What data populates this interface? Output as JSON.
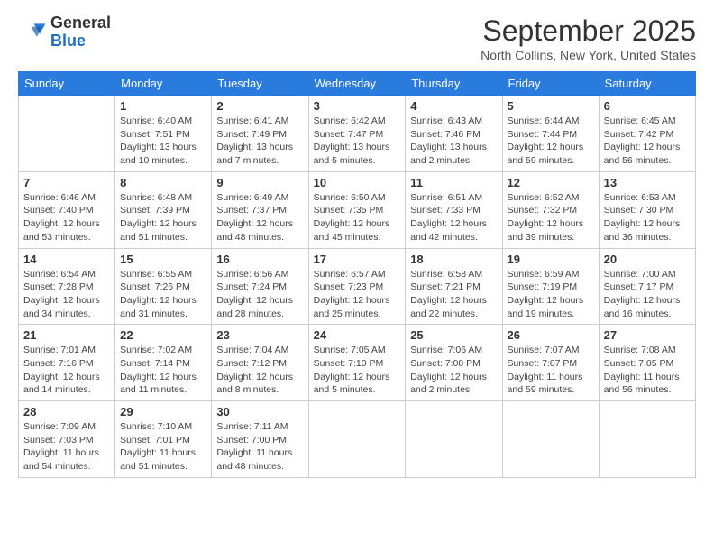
{
  "header": {
    "logo_general": "General",
    "logo_blue": "Blue",
    "month_title": "September 2025",
    "subtitle": "North Collins, New York, United States"
  },
  "days_of_week": [
    "Sunday",
    "Monday",
    "Tuesday",
    "Wednesday",
    "Thursday",
    "Friday",
    "Saturday"
  ],
  "weeks": [
    [
      {
        "day": "",
        "info": ""
      },
      {
        "day": "1",
        "info": "Sunrise: 6:40 AM\nSunset: 7:51 PM\nDaylight: 13 hours\nand 10 minutes."
      },
      {
        "day": "2",
        "info": "Sunrise: 6:41 AM\nSunset: 7:49 PM\nDaylight: 13 hours\nand 7 minutes."
      },
      {
        "day": "3",
        "info": "Sunrise: 6:42 AM\nSunset: 7:47 PM\nDaylight: 13 hours\nand 5 minutes."
      },
      {
        "day": "4",
        "info": "Sunrise: 6:43 AM\nSunset: 7:46 PM\nDaylight: 13 hours\nand 2 minutes."
      },
      {
        "day": "5",
        "info": "Sunrise: 6:44 AM\nSunset: 7:44 PM\nDaylight: 12 hours\nand 59 minutes."
      },
      {
        "day": "6",
        "info": "Sunrise: 6:45 AM\nSunset: 7:42 PM\nDaylight: 12 hours\nand 56 minutes."
      }
    ],
    [
      {
        "day": "7",
        "info": "Sunrise: 6:46 AM\nSunset: 7:40 PM\nDaylight: 12 hours\nand 53 minutes."
      },
      {
        "day": "8",
        "info": "Sunrise: 6:48 AM\nSunset: 7:39 PM\nDaylight: 12 hours\nand 51 minutes."
      },
      {
        "day": "9",
        "info": "Sunrise: 6:49 AM\nSunset: 7:37 PM\nDaylight: 12 hours\nand 48 minutes."
      },
      {
        "day": "10",
        "info": "Sunrise: 6:50 AM\nSunset: 7:35 PM\nDaylight: 12 hours\nand 45 minutes."
      },
      {
        "day": "11",
        "info": "Sunrise: 6:51 AM\nSunset: 7:33 PM\nDaylight: 12 hours\nand 42 minutes."
      },
      {
        "day": "12",
        "info": "Sunrise: 6:52 AM\nSunset: 7:32 PM\nDaylight: 12 hours\nand 39 minutes."
      },
      {
        "day": "13",
        "info": "Sunrise: 6:53 AM\nSunset: 7:30 PM\nDaylight: 12 hours\nand 36 minutes."
      }
    ],
    [
      {
        "day": "14",
        "info": "Sunrise: 6:54 AM\nSunset: 7:28 PM\nDaylight: 12 hours\nand 34 minutes."
      },
      {
        "day": "15",
        "info": "Sunrise: 6:55 AM\nSunset: 7:26 PM\nDaylight: 12 hours\nand 31 minutes."
      },
      {
        "day": "16",
        "info": "Sunrise: 6:56 AM\nSunset: 7:24 PM\nDaylight: 12 hours\nand 28 minutes."
      },
      {
        "day": "17",
        "info": "Sunrise: 6:57 AM\nSunset: 7:23 PM\nDaylight: 12 hours\nand 25 minutes."
      },
      {
        "day": "18",
        "info": "Sunrise: 6:58 AM\nSunset: 7:21 PM\nDaylight: 12 hours\nand 22 minutes."
      },
      {
        "day": "19",
        "info": "Sunrise: 6:59 AM\nSunset: 7:19 PM\nDaylight: 12 hours\nand 19 minutes."
      },
      {
        "day": "20",
        "info": "Sunrise: 7:00 AM\nSunset: 7:17 PM\nDaylight: 12 hours\nand 16 minutes."
      }
    ],
    [
      {
        "day": "21",
        "info": "Sunrise: 7:01 AM\nSunset: 7:16 PM\nDaylight: 12 hours\nand 14 minutes."
      },
      {
        "day": "22",
        "info": "Sunrise: 7:02 AM\nSunset: 7:14 PM\nDaylight: 12 hours\nand 11 minutes."
      },
      {
        "day": "23",
        "info": "Sunrise: 7:04 AM\nSunset: 7:12 PM\nDaylight: 12 hours\nand 8 minutes."
      },
      {
        "day": "24",
        "info": "Sunrise: 7:05 AM\nSunset: 7:10 PM\nDaylight: 12 hours\nand 5 minutes."
      },
      {
        "day": "25",
        "info": "Sunrise: 7:06 AM\nSunset: 7:08 PM\nDaylight: 12 hours\nand 2 minutes."
      },
      {
        "day": "26",
        "info": "Sunrise: 7:07 AM\nSunset: 7:07 PM\nDaylight: 11 hours\nand 59 minutes."
      },
      {
        "day": "27",
        "info": "Sunrise: 7:08 AM\nSunset: 7:05 PM\nDaylight: 11 hours\nand 56 minutes."
      }
    ],
    [
      {
        "day": "28",
        "info": "Sunrise: 7:09 AM\nSunset: 7:03 PM\nDaylight: 11 hours\nand 54 minutes."
      },
      {
        "day": "29",
        "info": "Sunrise: 7:10 AM\nSunset: 7:01 PM\nDaylight: 11 hours\nand 51 minutes."
      },
      {
        "day": "30",
        "info": "Sunrise: 7:11 AM\nSunset: 7:00 PM\nDaylight: 11 hours\nand 48 minutes."
      },
      {
        "day": "",
        "info": ""
      },
      {
        "day": "",
        "info": ""
      },
      {
        "day": "",
        "info": ""
      },
      {
        "day": "",
        "info": ""
      }
    ]
  ]
}
